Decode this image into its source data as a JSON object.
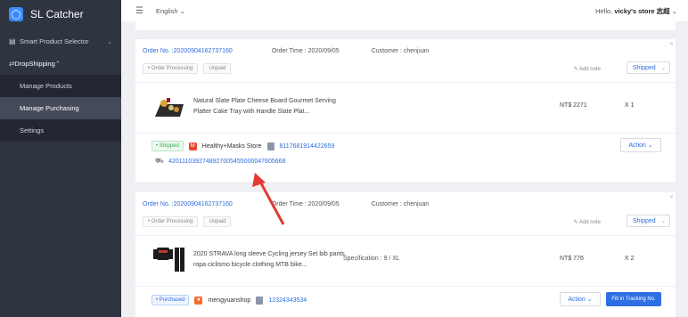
{
  "app": {
    "title": "SL Catcher"
  },
  "topbar": {
    "language": "English",
    "greeting_prefix": "Hello, ",
    "user": "vicky's store 志超"
  },
  "sidebar": {
    "items": [
      {
        "label": "Smart Product Selector"
      },
      {
        "label": "DropShipping"
      }
    ],
    "sub_items": [
      {
        "label": "Manage Products"
      },
      {
        "label": "Manage Purchasing"
      },
      {
        "label": "Settings"
      }
    ]
  },
  "orders": [
    {
      "order_no": "Order No. :20200904162737160",
      "order_time": "Order Time : 2020/09/05",
      "customer": "Customer :  chenjuan",
      "tags": [
        "• Order Processing",
        "Unpaid"
      ],
      "add_note": "Add note",
      "ship_status": "Shipped",
      "product_title": "Natural Slate Plate Cheese Board Gourmet Serving Platter Cake Tray with Handle Slate Plat...",
      "spec": "",
      "price": "NT$ 2271",
      "qty": "X 1",
      "status": "• Shipped",
      "store": "Healthy+Masks Store",
      "supplier_order": "8117681914422659",
      "tracking": "420111039274892700545500004760566​8",
      "action": "Action"
    },
    {
      "order_no": "Order No. :20200904162737160",
      "order_time": "Order Time : 2020/09/05",
      "customer": "Customer :  chenjuan",
      "tags": [
        "• Order Processing",
        "Unpaid"
      ],
      "add_note": "Add note",
      "ship_status": "Shipped",
      "product_title": "2020 STRAVA long sleeve Cycling jersey Set bib pants ropa ciclismo bicycle clothing MTB bike...",
      "spec": "Specification : 9 / XL",
      "price": "NT$ 776",
      "qty": "X 2",
      "status": "• Purchased",
      "store": "mengyuanshop",
      "supplier_order": "12324343534",
      "action": "Action",
      "fill_tracking": "Fill in Tracking No."
    }
  ],
  "colors": {
    "accent": "#2d6cdf",
    "sidebar": "#2f3441",
    "annotation_arrow": "#e53935"
  }
}
